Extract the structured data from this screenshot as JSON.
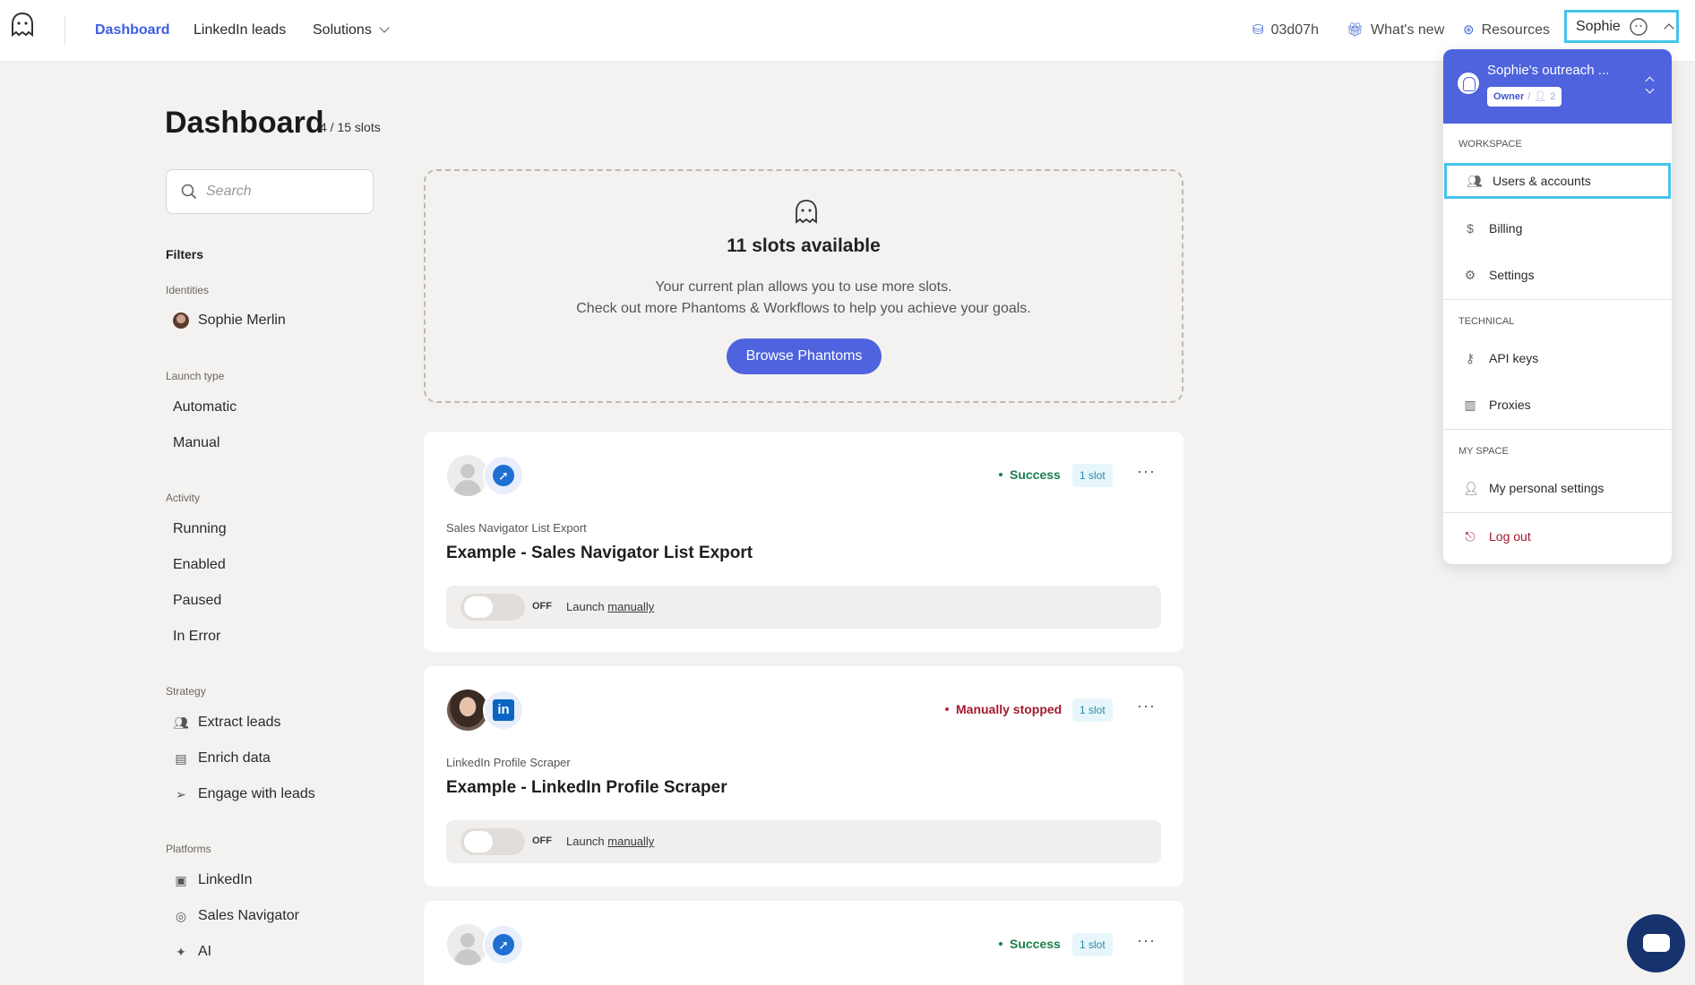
{
  "nav": {
    "links": [
      "Dashboard",
      "LinkedIn leads",
      "Solutions"
    ],
    "time_left": "03d07h",
    "whats_new": "What's new",
    "resources": "Resources",
    "user": "Sophie"
  },
  "header": {
    "title": "Dashboard",
    "slots": "4 / 15 slots"
  },
  "sidebar": {
    "search_placeholder": "Search",
    "filters_title": "Filters",
    "groups": [
      {
        "label": "Identities",
        "items": [
          "Sophie Merlin"
        ]
      },
      {
        "label": "Launch type",
        "items": [
          "Automatic",
          "Manual"
        ]
      },
      {
        "label": "Activity",
        "items": [
          "Running",
          "Enabled",
          "Paused",
          "In Error"
        ]
      },
      {
        "label": "Strategy",
        "items": [
          "Extract leads",
          "Enrich data",
          "Engage with leads"
        ]
      },
      {
        "label": "Platforms",
        "items": [
          "LinkedIn",
          "Sales Navigator",
          "AI"
        ]
      }
    ]
  },
  "slots_card": {
    "title": "11 slots available",
    "line1": "Your current plan allows you to use more slots.",
    "line2": "Check out more Phantoms & Workflows to help you achieve your goals.",
    "button": "Browse Phantoms"
  },
  "cards": [
    {
      "status": "Success",
      "slot": "1 slot",
      "type": "Sales Navigator List Export",
      "name": "Example - Sales Navigator List Export",
      "toggle": "OFF",
      "launch_prefix": "Launch",
      "launch_link": "manually"
    },
    {
      "status": "Manually stopped",
      "slot": "1 slot",
      "type": "LinkedIn Profile Scraper",
      "name": "Example - LinkedIn Profile Scraper",
      "toggle": "OFF",
      "launch_prefix": "Launch",
      "launch_link": "manually"
    },
    {
      "status": "Success",
      "slot": "1 slot"
    }
  ],
  "dropdown": {
    "workspace_name": "Sophie's outreach ...",
    "role": "Owner",
    "members": "2",
    "sections": {
      "workspace": "Workspace",
      "technical": "Technical",
      "my_space": "My space"
    },
    "items": {
      "users": "Users & accounts",
      "billing": "Billing",
      "settings": "Settings",
      "api_keys": "API keys",
      "proxies": "Proxies",
      "personal": "My personal settings",
      "logout": "Log out"
    }
  }
}
